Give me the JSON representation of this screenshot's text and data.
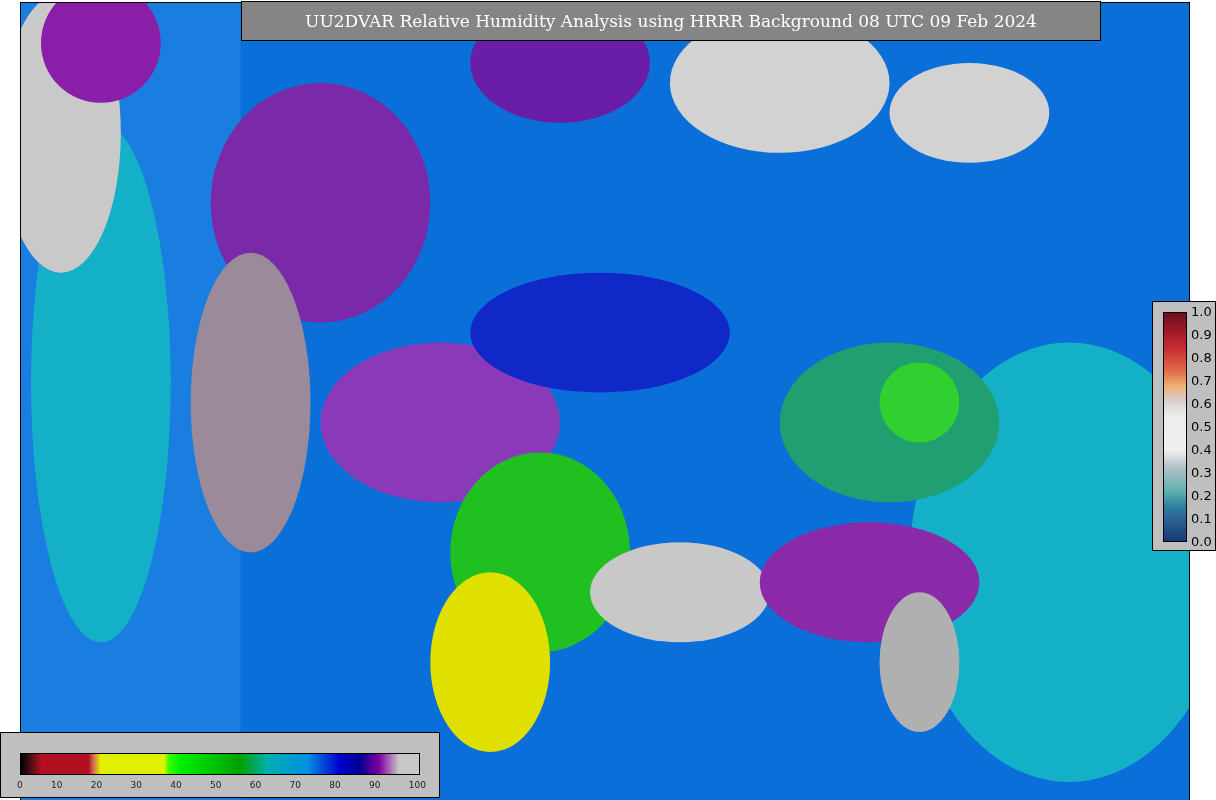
{
  "title": "UU2DVAR Relative Humidity Analysis using HRRR Background 08 UTC 09 Feb 2024",
  "right_colorbar": {
    "ticks": [
      "1.0",
      "0.9",
      "0.8",
      "0.7",
      "0.6",
      "0.5",
      "0.4",
      "0.3",
      "0.2",
      "0.1",
      "0.0"
    ]
  },
  "bottom_colorbar": {
    "ticks": [
      "0",
      "10",
      "20",
      "30",
      "40",
      "50",
      "60",
      "70",
      "80",
      "90",
      "100"
    ]
  }
}
